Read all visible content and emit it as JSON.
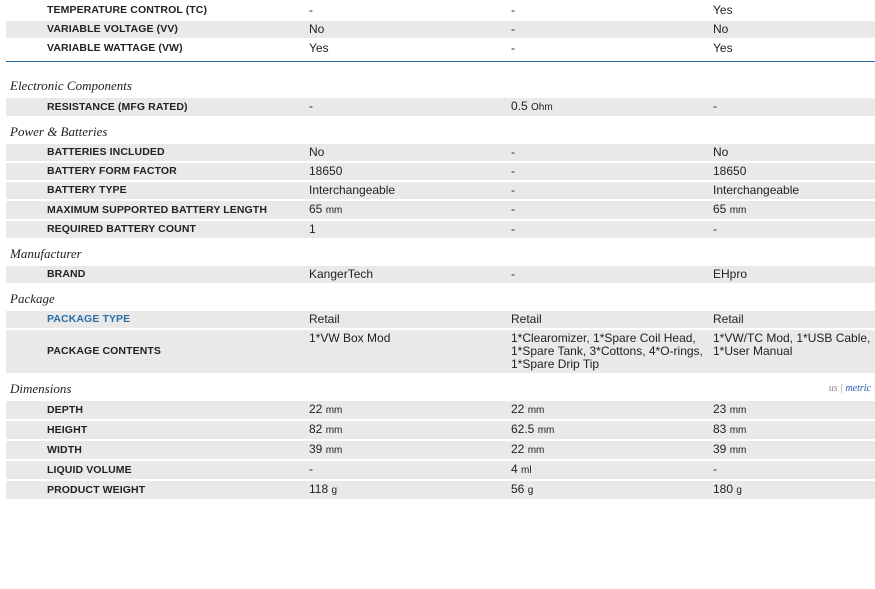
{
  "top_rows": [
    {
      "label": "TEMPERATURE CONTROL (TC)",
      "v": [
        "-",
        "-",
        "Yes"
      ],
      "shade": false
    },
    {
      "label": "VARIABLE VOLTAGE (VV)",
      "v": [
        "No",
        "-",
        "No"
      ],
      "shade": true
    },
    {
      "label": "VARIABLE WATTAGE (VW)",
      "v": [
        "Yes",
        "-",
        "Yes"
      ],
      "shade": false
    }
  ],
  "sections": [
    {
      "title": "Electronic Components",
      "rows": [
        {
          "label": "RESISTANCE (MFG RATED)",
          "v": [
            "-",
            "0.5",
            "-"
          ],
          "units": [
            "",
            "Ohm",
            ""
          ]
        }
      ]
    },
    {
      "title": "Power & Batteries",
      "rows": [
        {
          "label": "BATTERIES INCLUDED",
          "v": [
            "No",
            "-",
            "No"
          ],
          "units": [
            "",
            "",
            ""
          ]
        },
        {
          "label": "BATTERY FORM FACTOR",
          "v": [
            "18650",
            "-",
            "18650"
          ],
          "units": [
            "",
            "",
            ""
          ]
        },
        {
          "label": "BATTERY TYPE",
          "v": [
            "Interchangeable",
            "-",
            "Interchangeable"
          ],
          "units": [
            "",
            "",
            ""
          ]
        },
        {
          "label": "MAXIMUM SUPPORTED BATTERY LENGTH",
          "v": [
            "65",
            "-",
            "65"
          ],
          "units": [
            "mm",
            "",
            "mm"
          ]
        },
        {
          "label": "REQUIRED BATTERY COUNT",
          "v": [
            "1",
            "-",
            "-"
          ],
          "units": [
            "",
            "",
            ""
          ]
        }
      ]
    },
    {
      "title": "Manufacturer",
      "rows": [
        {
          "label": "BRAND",
          "v": [
            "KangerTech",
            "-",
            "EHpro"
          ],
          "units": [
            "",
            "",
            ""
          ]
        }
      ]
    },
    {
      "title": "Package",
      "rows": [
        {
          "label": "PACKAGE TYPE",
          "v": [
            "Retail",
            "Retail",
            "Retail"
          ],
          "units": [
            "",
            "",
            ""
          ],
          "link": true
        },
        {
          "label": "PACKAGE CONTENTS",
          "v": [
            "1*VW Box Mod",
            "1*Clearomizer, 1*Spare Coil Head, 1*Spare Tank, 3*Cottons, 4*O-rings, 1*Spare Drip Tip",
            "1*VW/TC Mod, 1*USB Cable, 1*User Manual"
          ],
          "units": [
            "",
            "",
            ""
          ]
        }
      ]
    },
    {
      "title": "Dimensions",
      "unit_toggle": {
        "us": "us",
        "sep": "|",
        "metric": "metric"
      },
      "rows": [
        {
          "label": "DEPTH",
          "v": [
            "22",
            "22",
            "23"
          ],
          "units": [
            "mm",
            "mm",
            "mm"
          ]
        },
        {
          "label": "HEIGHT",
          "v": [
            "82",
            "62.5",
            "83"
          ],
          "units": [
            "mm",
            "mm",
            "mm"
          ]
        },
        {
          "label": "WIDTH",
          "v": [
            "39",
            "22",
            "39"
          ],
          "units": [
            "mm",
            "mm",
            "mm"
          ]
        },
        {
          "label": "LIQUID VOLUME",
          "v": [
            "-",
            "4",
            "-"
          ],
          "units": [
            "",
            "ml",
            ""
          ]
        },
        {
          "label": "PRODUCT WEIGHT",
          "v": [
            "118",
            "56",
            "180"
          ],
          "units": [
            "g",
            "g",
            "g"
          ]
        }
      ]
    }
  ]
}
